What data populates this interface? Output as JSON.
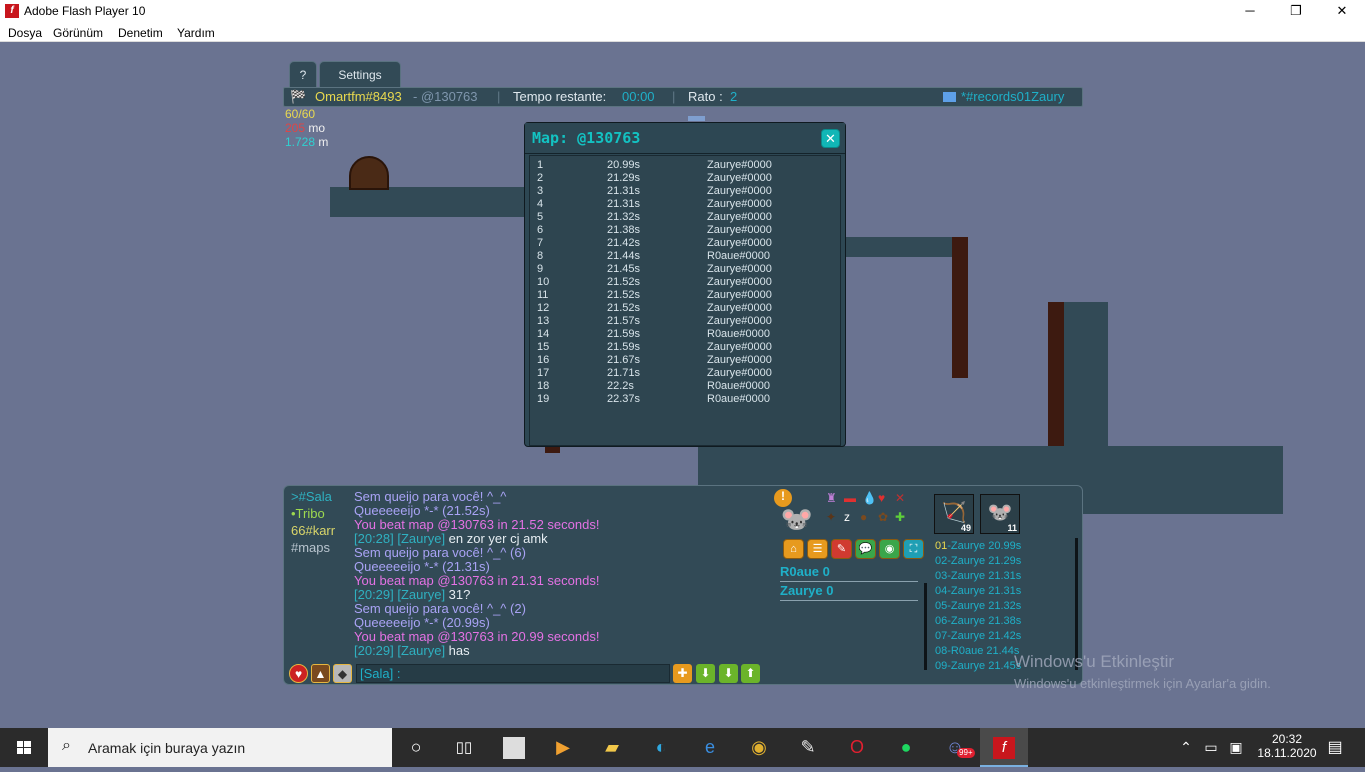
{
  "window": {
    "title": "Adobe Flash Player 10",
    "minimize": "─",
    "restore": "❐",
    "close": "✕"
  },
  "menu": [
    "Dosya",
    "Görünüm",
    "Denetim",
    "Yardım"
  ],
  "tabs": {
    "help": "?",
    "settings": "Settings"
  },
  "topbar": {
    "player": "Omartfm#8493",
    "map_code": "- @130763",
    "time_label": "Tempo restante:",
    "time_value": "00:00",
    "rato_label": "Rato :",
    "rato_value": "2",
    "room": "*#records01Zaury"
  },
  "stats": {
    "cheese": "60",
    "cheese_max": "/60",
    "mo_value": "205",
    "mo_unit": " mo",
    "m_value": "1.728",
    "m_unit": " m"
  },
  "map_window": {
    "title": "Map: @130763",
    "close": "✕",
    "records": [
      [
        "1",
        "20.99s",
        "Zaurye#0000"
      ],
      [
        "2",
        "21.29s",
        "Zaurye#0000"
      ],
      [
        "3",
        "21.31s",
        "Zaurye#0000"
      ],
      [
        "4",
        "21.31s",
        "Zaurye#0000"
      ],
      [
        "5",
        "21.32s",
        "Zaurye#0000"
      ],
      [
        "6",
        "21.38s",
        "Zaurye#0000"
      ],
      [
        "7",
        "21.42s",
        "Zaurye#0000"
      ],
      [
        "8",
        "21.44s",
        "R0aue#0000"
      ],
      [
        "9",
        "21.45s",
        "Zaurye#0000"
      ],
      [
        "10",
        "21.52s",
        "Zaurye#0000"
      ],
      [
        "11",
        "21.52s",
        "Zaurye#0000"
      ],
      [
        "12",
        "21.52s",
        "Zaurye#0000"
      ],
      [
        "13",
        "21.57s",
        "Zaurye#0000"
      ],
      [
        "14",
        "21.59s",
        "R0aue#0000"
      ],
      [
        "15",
        "21.59s",
        "Zaurye#0000"
      ],
      [
        "16",
        "21.67s",
        "Zaurye#0000"
      ],
      [
        "17",
        "21.71s",
        "Zaurye#0000"
      ],
      [
        "18",
        "22.2s",
        "R0aue#0000"
      ],
      [
        "19",
        "22.37s",
        "R0aue#0000"
      ]
    ]
  },
  "chat": {
    "channels": [
      {
        "text": ">#Sala",
        "color": "#2fb0c0"
      },
      {
        "text": "•Tribo",
        "color": "#9ed94f"
      },
      {
        "text": "66#karr",
        "color": "#d9d56a"
      },
      {
        "text": "#maps",
        "color": "#b8c4ce"
      }
    ],
    "lines": [
      {
        "p": [
          {
            "t": "Sem queijo para você! ^_^",
            "c": "#a9a3f5"
          }
        ]
      },
      {
        "p": [
          {
            "t": "Queeeeeijo *-* (21.52s)",
            "c": "#a9a3f5"
          }
        ]
      },
      {
        "p": [
          {
            "t": "You beat map @130763 in 21.52 seconds!",
            "c": "#e472e4"
          }
        ]
      },
      {
        "p": [
          {
            "t": "[20:28] [Zaurye] ",
            "c": "#2fb0c0"
          },
          {
            "t": "en zor yer cj amk",
            "c": "#e6edf2"
          }
        ]
      },
      {
        "p": [
          {
            "t": "Sem queijo para você! ^_^ (6)",
            "c": "#a9a3f5"
          }
        ]
      },
      {
        "p": [
          {
            "t": "Queeeeeijo *-* (21.31s)",
            "c": "#a9a3f5"
          }
        ]
      },
      {
        "p": [
          {
            "t": "You beat map @130763 in 21.31 seconds!",
            "c": "#e472e4"
          }
        ]
      },
      {
        "p": [
          {
            "t": "[20:29] [Zaurye] ",
            "c": "#2fb0c0"
          },
          {
            "t": "31?",
            "c": "#e6edf2"
          }
        ]
      },
      {
        "p": [
          {
            "t": "Sem queijo para você! ^_^ (2)",
            "c": "#a9a3f5"
          }
        ]
      },
      {
        "p": [
          {
            "t": "Queeeeeijo *-* (20.99s)",
            "c": "#a9a3f5"
          }
        ]
      },
      {
        "p": [
          {
            "t": "You beat map @130763 in 20.99 seconds!",
            "c": "#e472e4"
          }
        ]
      },
      {
        "p": [
          {
            "t": "[20:29] [Zaurye] ",
            "c": "#2fb0c0"
          },
          {
            "t": "has",
            "c": "#e6edf2"
          }
        ]
      }
    ],
    "input_placeholder": "[Sala] :"
  },
  "players": [
    {
      "name": "R0aue",
      "score": "0"
    },
    {
      "name": "Zaurye",
      "score": "0"
    }
  ],
  "avatar_badges": [
    "49",
    "11"
  ],
  "records_side": [
    {
      "n": "01",
      "rest": "-Zaurye 20.99s"
    },
    {
      "n": "02",
      "rest": "-Zaurye 21.29s"
    },
    {
      "n": "03",
      "rest": "-Zaurye 21.31s"
    },
    {
      "n": "04",
      "rest": "-Zaurye 21.31s"
    },
    {
      "n": "05",
      "rest": "-Zaurye 21.32s"
    },
    {
      "n": "06",
      "rest": "-Zaurye 21.38s"
    },
    {
      "n": "07",
      "rest": "-Zaurye 21.42s"
    },
    {
      "n": "08",
      "rest": "-R0aue 21.44s"
    },
    {
      "n": "09",
      "rest": "-Zaurye 21.45s"
    }
  ],
  "watermark": {
    "line1": "Windows'u Etkinleştir",
    "line2": "Windows'u etkinleştirmek için Ayarlar'a gidin."
  },
  "taskbar": {
    "search": "Aramak için buraya yazın",
    "time": "20:32",
    "date": "18.11.2020",
    "notif_badge": "99+"
  },
  "colors": {
    "bg": "#6a7391",
    "panel": "#324a56",
    "accent": "#1fb0c8",
    "title_accent": "#13c2c2"
  }
}
